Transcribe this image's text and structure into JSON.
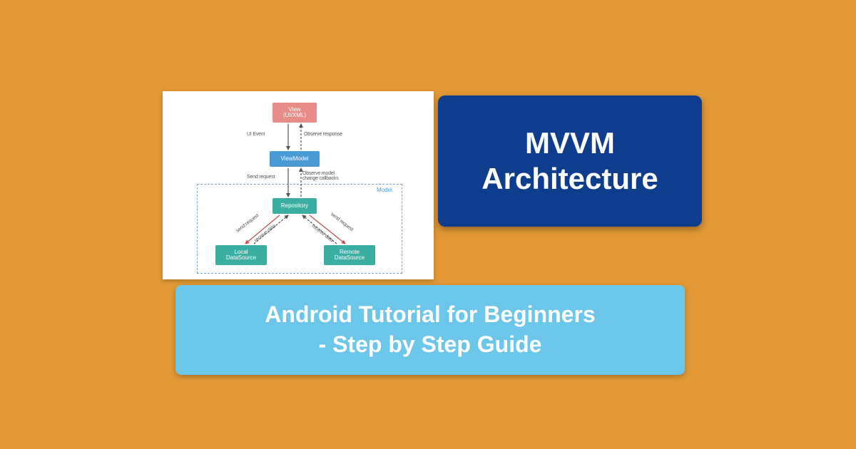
{
  "colors": {
    "background": "#e29936",
    "title_card": "#0d3d8c",
    "subtitle_card": "#6cc6ea",
    "view_node": "#e98c87",
    "vm_node": "#4a9ad6",
    "repo_node": "#3aaea0",
    "ds_node": "#3aaea0"
  },
  "title_card": {
    "line1": "MVVM",
    "line2": "Architecture"
  },
  "subtitle_card": {
    "line1": "Android Tutorial for Beginners",
    "line2": "- Step by Step Guide"
  },
  "diagram": {
    "nodes": {
      "view": "View\n(UI/XML)",
      "viewmodel": "ViewModel",
      "repository": "Repository",
      "local_ds": "Local\nDataSource",
      "remote_ds": "Remote\nDataSource"
    },
    "model_container_label": "Model",
    "edge_labels": {
      "ui_event": "UI Event",
      "observe_response": "Observe response",
      "send_request": "Send request",
      "observe_model_change": "Observe model\nchange callbacks",
      "send_data_l": "send request",
      "receive_data_l": "receive data",
      "send_data_r": "send request",
      "receive_data_r": "receive data"
    }
  }
}
